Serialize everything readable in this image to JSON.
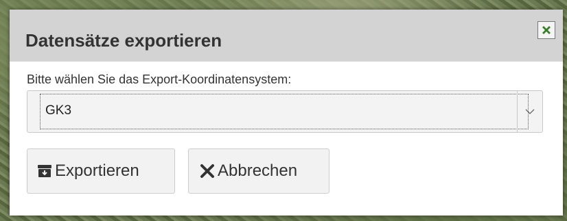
{
  "dialog": {
    "title": "Datensätze exportieren",
    "close_icon": "close-x-icon",
    "prompt_label": "Bitte wählen Sie das Export-Koordinatensystem:",
    "coordinate_system": {
      "selected": "GK3",
      "arrow_icon": "chevron-down-icon"
    },
    "export_button": {
      "label": "Exportieren",
      "icon": "archive-download-icon"
    },
    "cancel_button": {
      "label": "Abbrechen",
      "icon": "x-icon"
    }
  },
  "colors": {
    "header_bg": "#d3d3d3",
    "close_icon": "#3a7d2c",
    "button_bg": "#f2f2f2"
  }
}
